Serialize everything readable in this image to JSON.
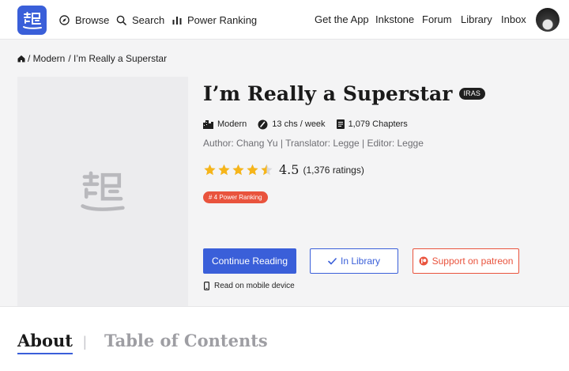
{
  "header": {
    "nav": [
      {
        "label": "Browse",
        "icon": "compass-icon"
      },
      {
        "label": "Search",
        "icon": "search-icon"
      },
      {
        "label": "Power Ranking",
        "icon": "bar-chart-icon"
      }
    ],
    "right_links": [
      "Get the App",
      "Inkstone",
      "Forum",
      "Library",
      "Inbox"
    ]
  },
  "breadcrumb": {
    "items": [
      "/ Modern",
      "/ I’m Really a Superstar"
    ]
  },
  "book": {
    "title": "I’m Really a Superstar",
    "badge": "IRAS",
    "genre": "Modern",
    "frequency": "13 chs / week",
    "chapters": "1,079 Chapters",
    "credits": "Author: Chang Yu  |  Translator: Legge  |  Editor: Legge",
    "rating_value": 4.5,
    "rating_display": "4.5",
    "rating_count": "(1,376 ratings)",
    "power_rank": "# 4 Power Ranking"
  },
  "actions": {
    "continue": "Continue Reading",
    "library": "In Library",
    "patreon": "Support on patreon",
    "mobile": "Read on mobile device"
  },
  "tabs": {
    "about": "About",
    "separator": "|",
    "toc": "Table of Contents"
  },
  "colors": {
    "accent": "#3a5fd9",
    "rank": "#e9533d",
    "star": "#f6b51a"
  }
}
